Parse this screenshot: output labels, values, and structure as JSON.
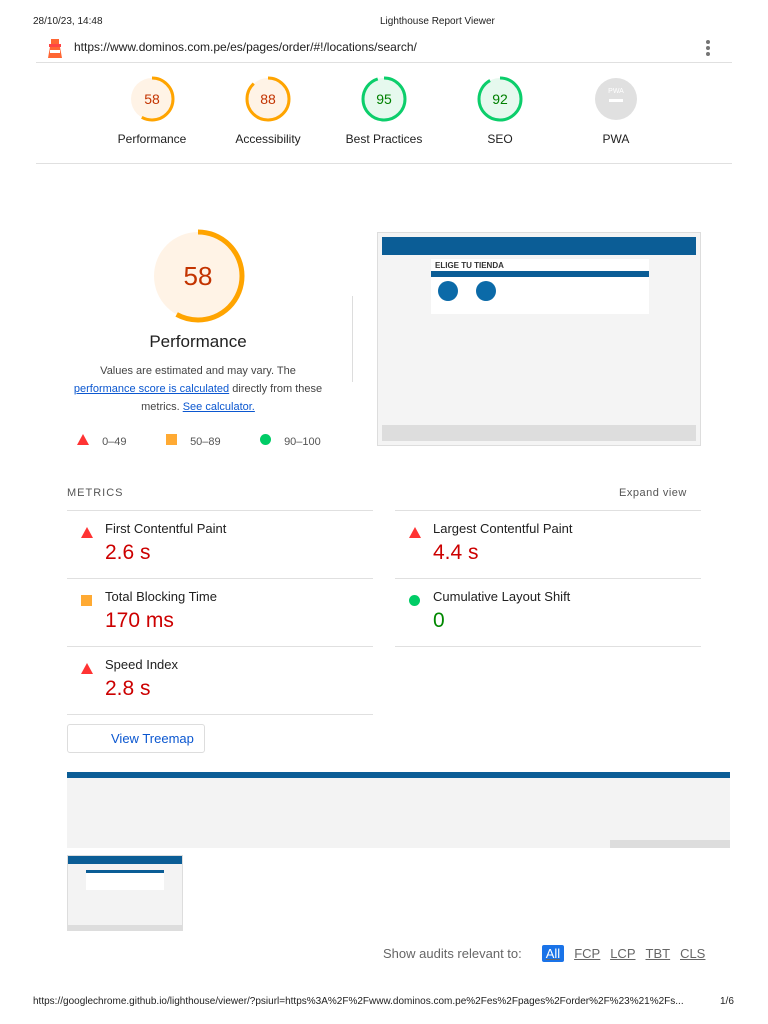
{
  "header": {
    "datetime": "28/10/23, 14:48",
    "title": "Lighthouse Report Viewer",
    "url": "https://www.dominos.com.pe/es/pages/order/#!/locations/search/"
  },
  "gauges": [
    {
      "label": "Performance",
      "score": "58",
      "color": "#ffa400",
      "bg": "#fff3e6",
      "text": "#c33300"
    },
    {
      "label": "Accessibility",
      "score": "88",
      "color": "#ffa400",
      "bg": "#fff3e6",
      "text": "#c33300"
    },
    {
      "label": "Best Practices",
      "score": "95",
      "color": "#0cce6b",
      "bg": "#e6f9ee",
      "text": "#008000"
    },
    {
      "label": "SEO",
      "score": "92",
      "color": "#0cce6b",
      "bg": "#e6f9ee",
      "text": "#008000"
    },
    {
      "label": "PWA",
      "score": "PWA",
      "color": "#ddd",
      "bg": "#e0e0e0",
      "text": "#aaa"
    }
  ],
  "performance": {
    "score": "58",
    "title": "Performance",
    "desc_1": "Values are estimated and may vary. The",
    "link_1": "performance score is calculated",
    "desc_2": "directly from these",
    "desc_3": "metrics.",
    "link_2": "See calculator.",
    "legend": [
      "0–49",
      "50–89",
      "90–100"
    ]
  },
  "screenshot": {
    "heading": "ELIGE TU TIENDA"
  },
  "metrics": {
    "title": "METRICS",
    "expand": "Expand view",
    "items": [
      {
        "name": "First Contentful Paint",
        "value": "2.6 s",
        "status": "fail"
      },
      {
        "name": "Largest Contentful Paint",
        "value": "4.4 s",
        "status": "fail"
      },
      {
        "name": "Total Blocking Time",
        "value": "170 ms",
        "status": "average"
      },
      {
        "name": "Cumulative Layout Shift",
        "value": "0",
        "status": "pass"
      },
      {
        "name": "Speed Index",
        "value": "2.8 s",
        "status": "fail"
      }
    ]
  },
  "treemap": "View Treemap",
  "filter": {
    "label": "Show audits relevant to:",
    "options": [
      "All",
      "FCP",
      "LCP",
      "TBT",
      "CLS"
    ]
  },
  "footer": {
    "url": "https://googlechrome.github.io/lighthouse/viewer/?psiurl=https%3A%2F%2Fwww.dominos.com.pe%2Fes%2Fpages%2Forder%2F%23%21%2Fs...",
    "page": "1/6"
  }
}
